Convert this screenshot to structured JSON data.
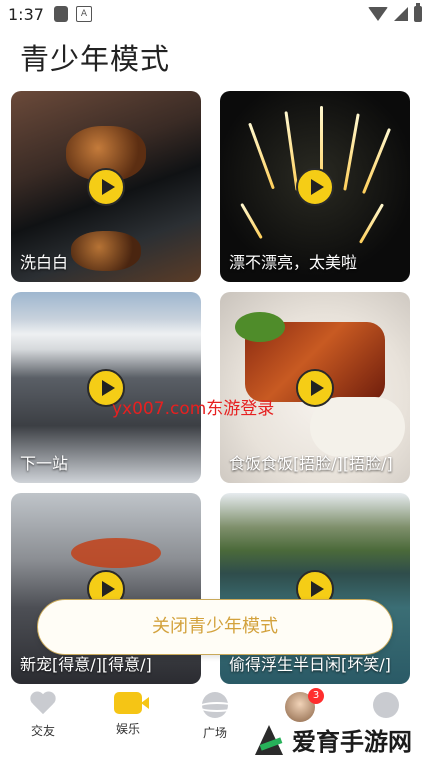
{
  "status_bar": {
    "time": "1:37",
    "a_icon_text": "A"
  },
  "page": {
    "title": "青少年模式"
  },
  "videos": [
    {
      "caption": "洗白白"
    },
    {
      "caption": "漂不漂亮，太美啦"
    },
    {
      "caption": "下一站"
    },
    {
      "caption": "食饭食饭[捂脸/][捂脸/]"
    },
    {
      "caption": "新宠[得意/][得意/]"
    },
    {
      "caption": "偷得浮生半日闲[坏笑/]"
    }
  ],
  "watermark": "yx007.com东游登录",
  "close_button": {
    "label": "关闭青少年模式"
  },
  "nav": {
    "items": [
      {
        "label": "交友",
        "icon": "heart-icon"
      },
      {
        "label": "娱乐",
        "icon": "video-camera-icon"
      },
      {
        "label": "广场",
        "icon": "planet-icon"
      },
      {
        "label": "",
        "icon": "avatar"
      },
      {
        "label": "",
        "icon": "profile-icon"
      }
    ],
    "badge_count": "3"
  },
  "logo": {
    "text": "爱育手游网"
  },
  "colors": {
    "accent": "#f5cd16",
    "button_text": "#d3a23d",
    "badge": "#ff2d2d"
  }
}
